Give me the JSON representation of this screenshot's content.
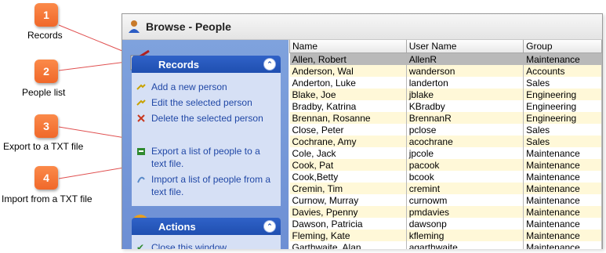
{
  "window": {
    "title": "Browse - People"
  },
  "callouts": [
    {
      "number": "1",
      "label": "Records"
    },
    {
      "number": "2",
      "label": "People list"
    },
    {
      "number": "3",
      "label": "Export to a TXT file"
    },
    {
      "number": "4",
      "label": "Import from a TXT file"
    }
  ],
  "records_panel": {
    "title": "Records",
    "tasks": [
      {
        "label": "Add a new person",
        "icon": "add-person-icon"
      },
      {
        "label": "Edit the selected person",
        "icon": "edit-person-icon"
      },
      {
        "label": "Delete the selected person",
        "icon": "delete-person-icon"
      },
      {
        "label": "Export a list of people to a text file.",
        "icon": "export-icon"
      },
      {
        "label": "Import a list of people from a text file.",
        "icon": "import-icon"
      }
    ]
  },
  "actions_panel": {
    "title": "Actions",
    "tasks": [
      {
        "label": "Close this window",
        "icon": "checkmark-icon"
      }
    ]
  },
  "grid": {
    "columns": [
      "Name",
      "User Name",
      "Group"
    ],
    "rows": [
      [
        "Allen, Robert",
        "AllenR",
        "Maintenance"
      ],
      [
        "Anderson, Wal",
        "wanderson",
        "Accounts"
      ],
      [
        "Anderton, Luke",
        "landerton",
        "Sales"
      ],
      [
        "Blake, Joe",
        "jblake",
        "Engineering"
      ],
      [
        "Bradby, Katrina",
        "KBradby",
        "Engineering"
      ],
      [
        "Brennan, Rosanne",
        "BrennanR",
        "Engineering"
      ],
      [
        "Close, Peter",
        "pclose",
        "Sales"
      ],
      [
        "Cochrane, Amy",
        "acochrane",
        "Sales"
      ],
      [
        "Cole, Jack",
        "jpcole",
        "Maintenance"
      ],
      [
        "Cook, Pat",
        "pacook",
        "Maintenance"
      ],
      [
        "Cook,Betty",
        "bcook",
        "Maintenance"
      ],
      [
        "Cremin, Tim",
        "cremint",
        "Maintenance"
      ],
      [
        "Curnow, Murray",
        "curnowm",
        "Maintenance"
      ],
      [
        "Davies, Ppenny",
        "pmdavies",
        "Maintenance"
      ],
      [
        "Dawson, Patricia",
        "dawsonp",
        "Maintenance"
      ],
      [
        "Fleming, Kate",
        "kfleming",
        "Maintenance"
      ],
      [
        "Garthwaite, Alan",
        "agarthwaite",
        "Maintenance"
      ]
    ],
    "selected_row": 0
  }
}
